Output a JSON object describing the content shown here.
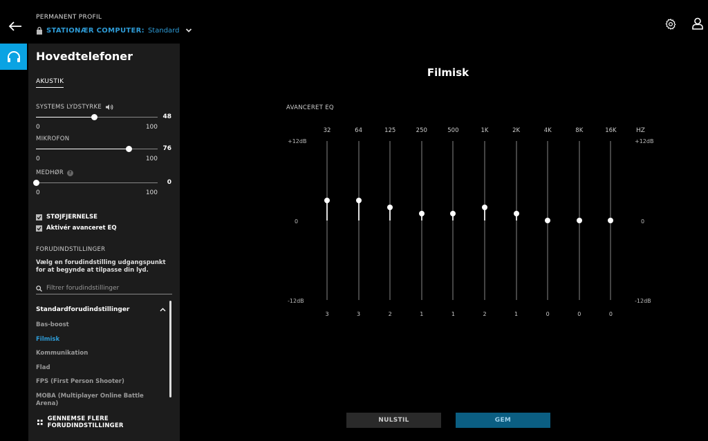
{
  "header": {
    "profile_label": "PERMANENT PROFIL",
    "device": "STATIONÆR COMPUTER:",
    "profile_name": "Standard",
    "icons": [
      "back-arrow-icon",
      "lock-icon",
      "chevron-down-icon",
      "gear-icon",
      "user-icon"
    ]
  },
  "rail": {
    "icon": "headphones-icon",
    "accent": "#0aa3e3"
  },
  "panel": {
    "title": "Hovedtelefoner",
    "tab": "AKUSTIK",
    "system_volume": {
      "label": "SYSTEMS LYDSTYRKE",
      "value": 48,
      "min": "0",
      "max": "100"
    },
    "microphone": {
      "label": "MIKROFON",
      "value": 76,
      "min": "0",
      "max": "100"
    },
    "sidetone": {
      "label": "MEDHØR",
      "value": 0,
      "min": "0",
      "max": "100"
    },
    "noise_reduction": {
      "label": "STØJFJERNELSE",
      "checked": true
    },
    "advanced_eq": {
      "label": "Aktivér avanceret EQ",
      "checked": true
    },
    "presets": {
      "heading": "FORUDINDSTILLINGER",
      "description": "Vælg en forudindstilling udgangspunkt for at begynde at tilpasse din lyd.",
      "filter_placeholder": "Filtrer forudindstillinger",
      "group": "Standardforudindstillinger",
      "items": [
        {
          "label": "Bas-boost"
        },
        {
          "label": "Filmisk"
        },
        {
          "label": "Kommunikation"
        },
        {
          "label": "Flad"
        },
        {
          "label": "FPS (First Person Shooter)"
        },
        {
          "label": "MOBA (Multiplayer Online Battle Arena)"
        }
      ],
      "active_index": 1,
      "browse": "GENNEMSE FLERE FORUDINDSTILLINGER"
    }
  },
  "main": {
    "title": "Filmisk",
    "eq_label": "AVANCERET EQ",
    "hz_label": "HZ",
    "db_top": "+12dB",
    "db_mid": "0",
    "db_bottom": "-12dB",
    "gain_range": [
      -12,
      12
    ],
    "bands": [
      {
        "freq": "32",
        "gain": 3
      },
      {
        "freq": "64",
        "gain": 3
      },
      {
        "freq": "125",
        "gain": 2
      },
      {
        "freq": "250",
        "gain": 1
      },
      {
        "freq": "500",
        "gain": 1
      },
      {
        "freq": "1K",
        "gain": 2
      },
      {
        "freq": "2K",
        "gain": 1
      },
      {
        "freq": "4K",
        "gain": 0
      },
      {
        "freq": "8K",
        "gain": 0
      },
      {
        "freq": "16K",
        "gain": 0
      }
    ],
    "reset_label": "NULSTIL",
    "save_label": "GEM"
  }
}
